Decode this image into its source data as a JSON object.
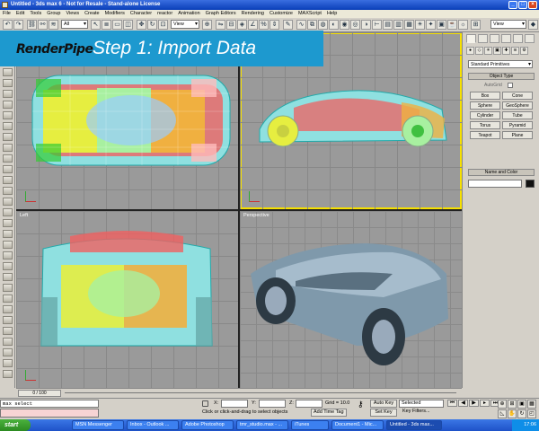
{
  "window": {
    "title": "Untitled - 3ds max 6 - Not for Resale - Stand-alone License"
  },
  "menubar": {
    "items": [
      "File",
      "Edit",
      "Tools",
      "Group",
      "Views",
      "Create",
      "Modifiers",
      "Character",
      "reactor",
      "Animation",
      "Graph Editors",
      "Rendering",
      "Customize",
      "MAXScript",
      "Help"
    ]
  },
  "toolbar": {
    "selection_filter": "All",
    "coord_system": "View",
    "named_selection": "View"
  },
  "banner": {
    "brand": "RenderPipe",
    "step": "Step 1: Import Data"
  },
  "viewports": {
    "left_label": "Left",
    "perspective_label": "Perspective"
  },
  "command_panel": {
    "category": "Standard Primitives",
    "object_type_header": "Object Type",
    "autogrid_label": "AutoGrid",
    "primitives": [
      "Box",
      "Cone",
      "Sphere",
      "GeoSphere",
      "Cylinder",
      "Tube",
      "Torus",
      "Pyramid",
      "Teapot",
      "Plane"
    ],
    "name_color_header": "Name and Color",
    "color": "#111111"
  },
  "time_slider": {
    "frame": "0 / 100"
  },
  "status": {
    "maxscript_line": "max select",
    "x_label": "X:",
    "y_label": "Y:",
    "z_label": "Z:",
    "grid": "Grid = 10.0",
    "prompt": "Click or click-and-drag to select objects",
    "add_time_tag": "Add Time Tag",
    "auto_key": "Auto Key",
    "set_key": "Set Key",
    "selected": "Selected",
    "key_filters": "Key Filters..."
  },
  "taskbar": {
    "start": "start",
    "tasks": [
      "MSN Messenger",
      "Inbox - Outlook ...",
      "Adobe Photoshop",
      "tmr_studio.max - ...",
      "iTunes",
      "Document1 - Mic...",
      "Untitled - 3ds max..."
    ],
    "clock": "17:06"
  }
}
